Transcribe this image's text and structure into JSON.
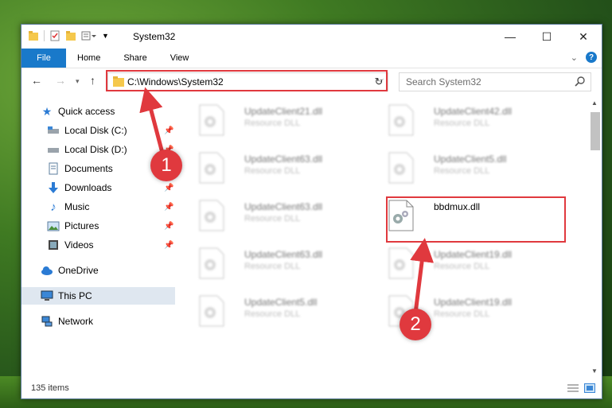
{
  "window": {
    "title": "System32",
    "controls": {
      "minimize": "—",
      "maximize": "☐",
      "close": "✕"
    }
  },
  "ribbon": {
    "file_tab": "File",
    "tabs": [
      "Home",
      "Share",
      "View"
    ]
  },
  "address_bar": {
    "path": "C:\\Windows\\System32",
    "dropdown": "⌵",
    "refresh": "↻"
  },
  "search": {
    "placeholder": "Search System32"
  },
  "sidebar": {
    "items": [
      {
        "label": "Quick access",
        "icon": "star-icon"
      },
      {
        "label": "Local Disk (C:)",
        "icon": "drive-icon",
        "pinned": true
      },
      {
        "label": "Local Disk (D:)",
        "icon": "drive-icon",
        "pinned": true
      },
      {
        "label": "Documents",
        "icon": "documents-icon",
        "pinned": true
      },
      {
        "label": "Downloads",
        "icon": "download-icon",
        "pinned": true
      },
      {
        "label": "Music",
        "icon": "music-icon",
        "pinned": true
      },
      {
        "label": "Pictures",
        "icon": "pictures-icon",
        "pinned": true
      },
      {
        "label": "Videos",
        "icon": "videos-icon",
        "pinned": true
      },
      {
        "label": "OneDrive",
        "icon": "cloud-icon"
      },
      {
        "label": "This PC",
        "icon": "pc-icon",
        "selected": true
      },
      {
        "label": "Network",
        "icon": "network-icon"
      }
    ]
  },
  "files": [
    {
      "name": "UpdateClient21.dll",
      "type": "Resource DLL",
      "blurred": true
    },
    {
      "name": "UpdateClient42.dll",
      "type": "Resource DLL",
      "blurred": true
    },
    {
      "name": "UpdateClient63.dll",
      "type": "Resource DLL",
      "blurred": true
    },
    {
      "name": "UpdateClient5.dll",
      "type": "Resource DLL",
      "blurred": true
    },
    {
      "name": "UpdateClient63.dll",
      "type": "Resource DLL",
      "blurred": true
    },
    {
      "name": "bbdmux.dll",
      "type": "",
      "blurred": false,
      "highlighted": true
    },
    {
      "name": "UpdateClient63.dll",
      "type": "Resource DLL",
      "blurred": true
    },
    {
      "name": "UpdateClient19.dll",
      "type": "Resource DLL",
      "blurred": true
    },
    {
      "name": "UpdateClient5.dll",
      "type": "Resource DLL",
      "blurred": true
    },
    {
      "name": "UpdateClient19.dll",
      "type": "Resource DLL",
      "blurred": true
    }
  ],
  "status": {
    "item_count": "135 items"
  },
  "callouts": {
    "step1": "1",
    "step2": "2"
  },
  "colors": {
    "accent": "#1979ca",
    "highlight": "#e0393e",
    "selected_bg": "#dfe7f0"
  }
}
